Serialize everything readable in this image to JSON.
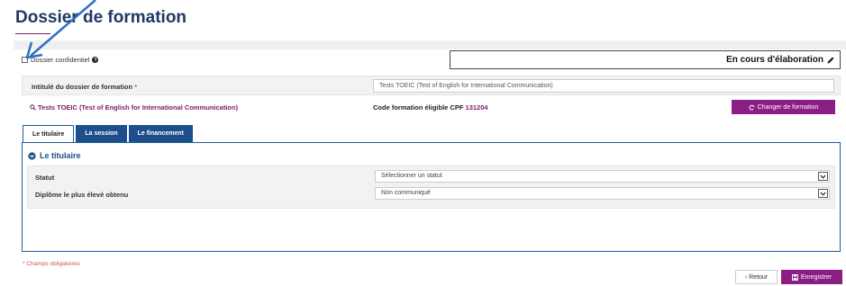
{
  "page": {
    "title": "Dossier de formation"
  },
  "confidential": {
    "label": "Dossier confidentiel",
    "checked": false,
    "help_icon": "question-circle-icon"
  },
  "status": {
    "label": "En cours d'élaboration",
    "icon": "pencil-icon"
  },
  "dossier_field": {
    "label": "Intitulé du dossier de formation",
    "required_marker": "*",
    "value": "Tests TOEIC (Test of English for International Communication)"
  },
  "course": {
    "link_label": "Tests TOEIC (Test of English for International Communication)",
    "link_icon": "search-icon",
    "code_label": "Code formation éligible CPF",
    "code_value": "131204",
    "change_button": "Changer de formation",
    "change_icon": "refresh-icon"
  },
  "tabs": [
    {
      "label": "Le titulaire",
      "active": true
    },
    {
      "label": "La session",
      "active": false
    },
    {
      "label": "Le financement",
      "active": false
    }
  ],
  "section": {
    "title": "Le titulaire",
    "icon": "chevron-circle-down-icon"
  },
  "rows": [
    {
      "label": "Statut",
      "value": "Sélectionner un statut"
    },
    {
      "label": "Diplôme le plus élevé obtenu",
      "value": "Non communiqué"
    }
  ],
  "footer": {
    "required_note": "* Champs obligatoires",
    "back_button": "‹ Retour",
    "save_button": "Enregistrer",
    "save_icon": "floppy-disk-icon"
  },
  "colors": {
    "title": "#203864",
    "brand_purple": "#8a1e83",
    "tab_blue": "#1c4f8c",
    "required_red": "#d9534f",
    "annotation_arrow": "#2f6fc4"
  }
}
